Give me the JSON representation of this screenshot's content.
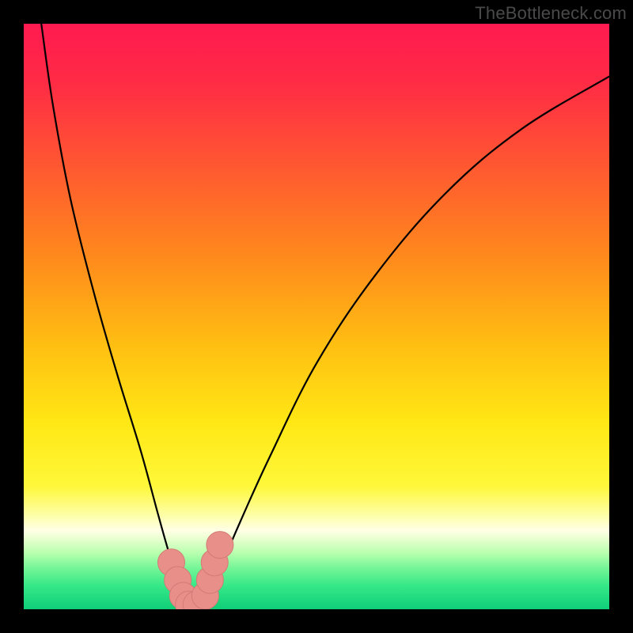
{
  "watermark": "TheBottleneck.com",
  "colors": {
    "frame": "#000000",
    "gradient_stops": [
      {
        "offset": 0.0,
        "color": "#ff1a50"
      },
      {
        "offset": 0.1,
        "color": "#ff2b45"
      },
      {
        "offset": 0.25,
        "color": "#ff5a30"
      },
      {
        "offset": 0.4,
        "color": "#ff8a1c"
      },
      {
        "offset": 0.55,
        "color": "#ffbf12"
      },
      {
        "offset": 0.68,
        "color": "#ffe714"
      },
      {
        "offset": 0.79,
        "color": "#fff83a"
      },
      {
        "offset": 0.845,
        "color": "#fdffb5"
      },
      {
        "offset": 0.865,
        "color": "#ffffe6"
      },
      {
        "offset": 0.88,
        "color": "#e8ffcf"
      },
      {
        "offset": 0.905,
        "color": "#b5ffad"
      },
      {
        "offset": 0.93,
        "color": "#74f597"
      },
      {
        "offset": 0.96,
        "color": "#35e888"
      },
      {
        "offset": 1.0,
        "color": "#0fce78"
      }
    ],
    "curve": "#000000",
    "marker_fill": "#e98f8a",
    "marker_stroke": "#d47a76"
  },
  "chart_data": {
    "type": "line",
    "title": "",
    "xlabel": "",
    "ylabel": "",
    "xlim": [
      0,
      100
    ],
    "ylim": [
      0,
      100
    ],
    "series": [
      {
        "name": "bottleneck-curve",
        "x": [
          3,
          5,
          8,
          12,
          16,
          20,
          23,
          25,
          27,
          28.5,
          30,
          32,
          34,
          37,
          42,
          50,
          60,
          72,
          85,
          100
        ],
        "y": [
          100,
          86,
          70,
          54,
          40,
          27,
          16,
          9,
          3,
          0.5,
          0.5,
          3,
          8,
          15,
          26,
          42,
          57,
          71,
          82,
          91
        ]
      }
    ],
    "markers": {
      "name": "highlight-dots",
      "x": [
        25.2,
        26.3,
        27.2,
        28.2,
        29.5,
        31.0,
        31.8,
        32.6,
        33.5
      ],
      "y": [
        8.0,
        5.0,
        2.3,
        0.8,
        0.8,
        2.3,
        5.0,
        8.0,
        11.0
      ],
      "r": 2.3
    }
  }
}
